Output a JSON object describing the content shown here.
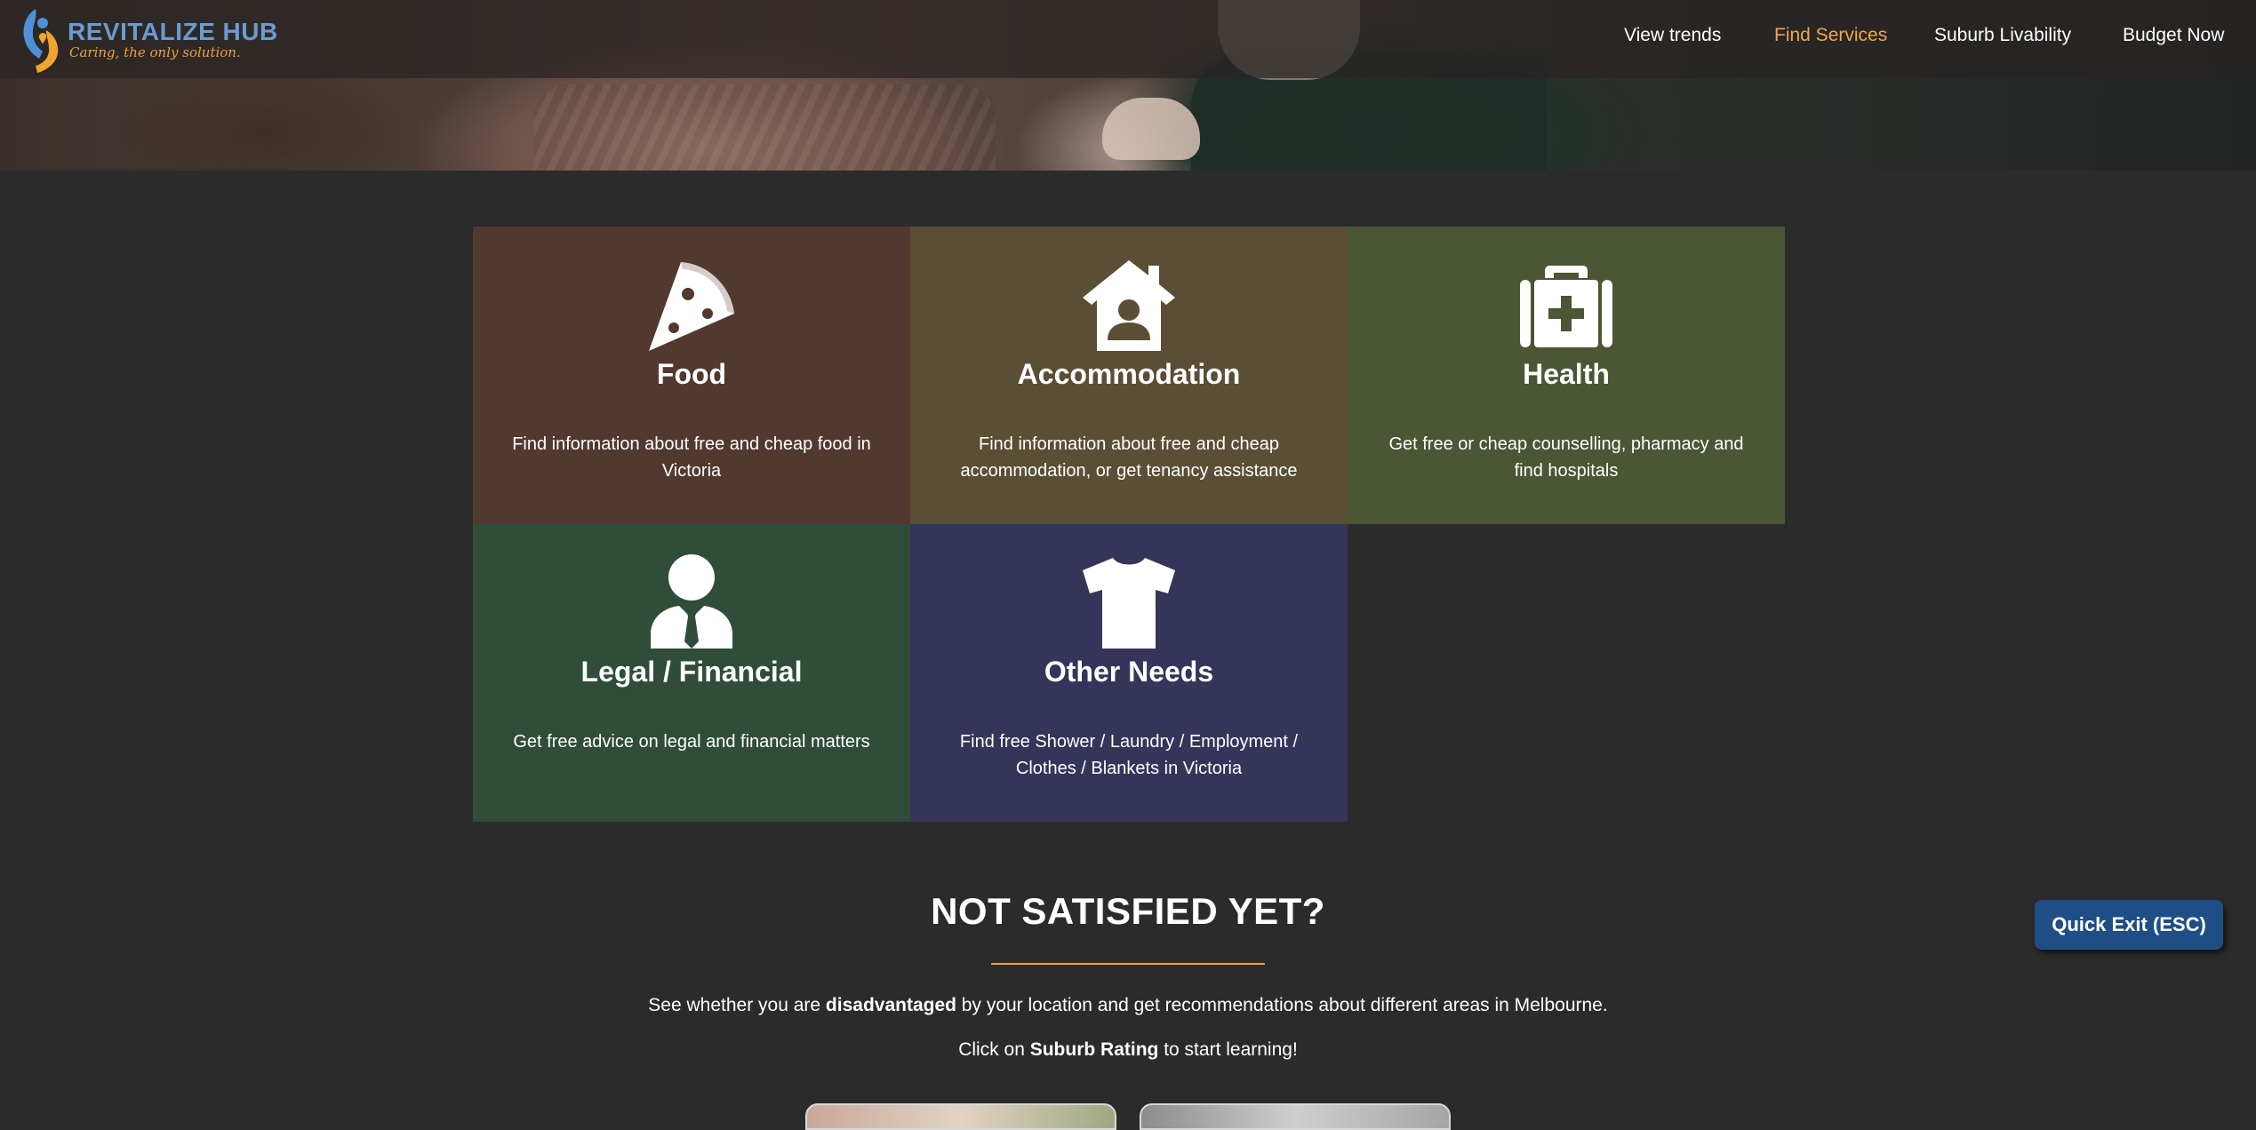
{
  "brand": {
    "name": "REVITALIZE HUB",
    "tagline": "Caring, the only solution."
  },
  "nav": {
    "items": [
      {
        "label": "View trends",
        "active": false
      },
      {
        "label": "Find Services",
        "active": true
      },
      {
        "label": "Suburb Livability",
        "active": false
      },
      {
        "label": "Budget Now",
        "active": false
      }
    ]
  },
  "services": [
    {
      "title": "Food",
      "description": "Find information about free and cheap food in Victoria",
      "color": "#523930",
      "icon": "pizza-icon"
    },
    {
      "title": "Accommodation",
      "description": "Find information about free and cheap accommodation, or get tenancy assistance",
      "color": "#5a4e34",
      "icon": "house-user-icon"
    },
    {
      "title": "Health",
      "description": "Get free or cheap counselling, pharmacy and find hospitals",
      "color": "#4a5634",
      "icon": "medkit-icon"
    },
    {
      "title": "Legal / Financial",
      "description": "Get free advice on legal and financial matters",
      "color": "#2f4d39",
      "icon": "user-tie-icon"
    },
    {
      "title": "Other Needs",
      "description": "Find free Shower / Laundry / Employment / Clothes / Blankets in Victoria",
      "color": "#35355a",
      "icon": "tshirt-icon"
    }
  ],
  "cta": {
    "title": "NOT SATISFIED YET?",
    "line1_pre": "See whether you are ",
    "line1_bold": "disadvantaged",
    "line1_post": " by your location and get recommendations about different areas in Melbourne.",
    "line2_pre": "Click on ",
    "line2_bold": "Suburb Rating",
    "line2_post": " to start learning!"
  },
  "quick_exit": {
    "label": "Quick Exit (ESC)"
  },
  "colors": {
    "accent": "#f0a84a",
    "background": "#2b2b2b",
    "quick_exit_bg": "#1f4e86",
    "brand_blue": "#6a9bd1"
  }
}
